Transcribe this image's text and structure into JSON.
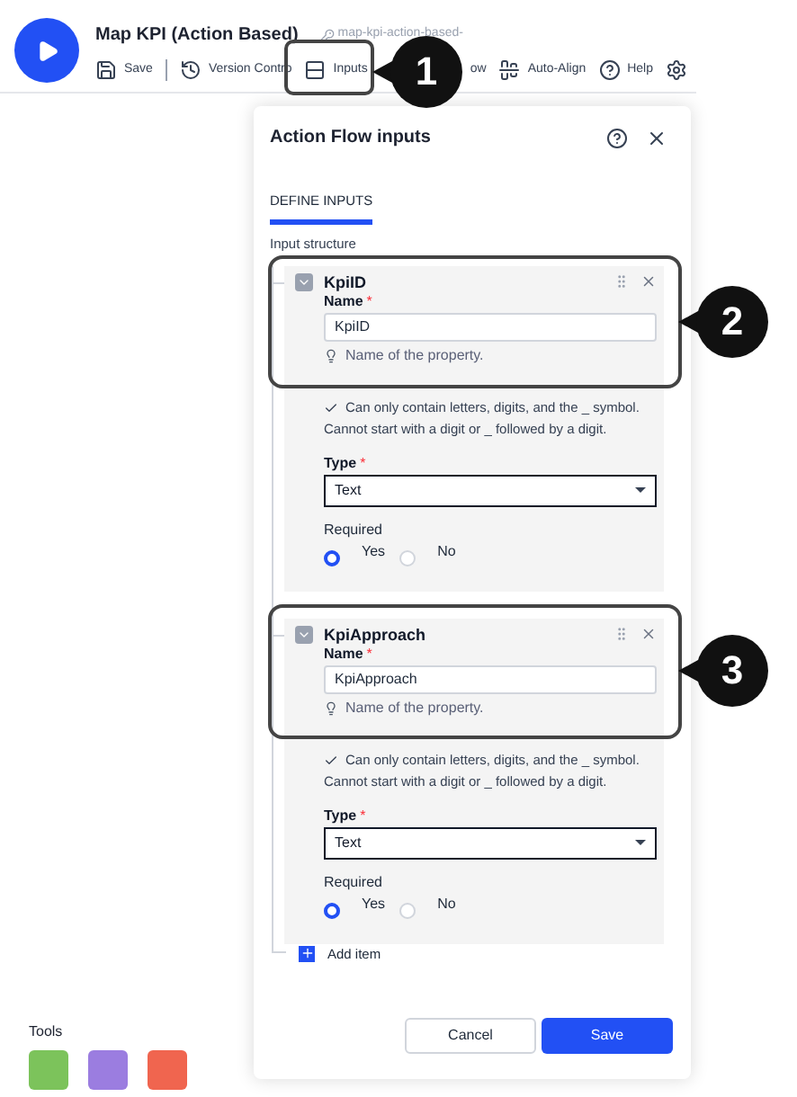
{
  "header": {
    "title": "Map KPI (Action Based)",
    "slug": "map-kpi-action-based-",
    "toolbar": [
      {
        "kind": "save",
        "label": "Save"
      },
      {
        "kind": "history",
        "label": "Version Contro"
      },
      {
        "kind": "inputs",
        "label": "Inputs"
      },
      {
        "kind": "cut",
        "label": "ow"
      },
      {
        "kind": "align",
        "label": "Auto-Align"
      },
      {
        "kind": "help",
        "label": "Help"
      },
      {
        "kind": "settings"
      }
    ]
  },
  "panel": {
    "title": "Action Flow inputs",
    "tabs": [
      {
        "label": "DEFINE INPUTS",
        "selected": true
      }
    ],
    "section_label": "Input structure",
    "items": [
      {
        "title": "KpiID",
        "required_mark": "*",
        "name_label": "Name",
        "name_value": "KpiID",
        "hint": "Name of the property.",
        "rule_1": "Can only contain letters, digits, and the _ symbol.",
        "rule_2": "Cannot start with a digit or _ followed by a digit.",
        "type_label": "Type",
        "type_value": "Text",
        "required_label": "Required",
        "options": [
          {
            "label": "Yes",
            "selected": true
          },
          {
            "label": "No",
            "selected": false
          }
        ]
      },
      {
        "title": "KpiApproach",
        "required_mark": "*",
        "name_label": "Name",
        "name_value": "KpiApproach",
        "hint": "Name of the property.",
        "rule_1": "Can only contain letters, digits, and the _ symbol.",
        "rule_2": "Cannot start with a digit or _ followed by a digit.",
        "type_label": "Type",
        "type_value": "Text",
        "required_label": "Required",
        "options": [
          {
            "label": "Yes",
            "selected": true
          },
          {
            "label": "No",
            "selected": false
          }
        ]
      }
    ],
    "add_item": "Add item",
    "buttons": [
      {
        "kind": "secondary",
        "label": "Cancel"
      },
      {
        "kind": "primary",
        "label": "Save"
      }
    ]
  },
  "tools": {
    "title": "Tools",
    "items": [
      {
        "color": "#7cc35b"
      },
      {
        "color": "#9b7de0"
      },
      {
        "color": "#f0654f"
      }
    ]
  },
  "callouts": [
    {
      "number": "1"
    },
    {
      "number": "2"
    },
    {
      "number": "3"
    }
  ]
}
